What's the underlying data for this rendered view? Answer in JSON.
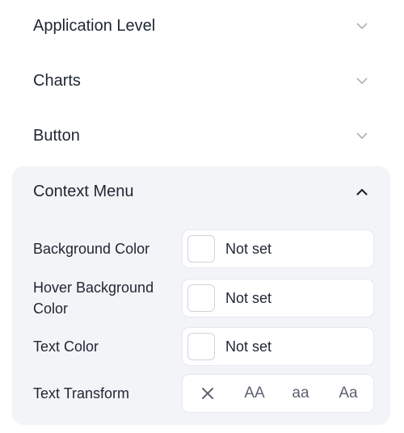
{
  "sections": [
    {
      "title": "Application Level",
      "icon": "chevron-down-icon"
    },
    {
      "title": "Charts",
      "icon": "chevron-down-icon"
    },
    {
      "title": "Button",
      "icon": "chevron-down-icon"
    }
  ],
  "context_menu": {
    "title": "Context Menu",
    "icon": "chevron-up-icon",
    "background_color": {
      "label": "Background Color",
      "value": "Not set"
    },
    "hover_background_color": {
      "label_line1": "Hover Background",
      "label_line2": "Color",
      "value": "Not set"
    },
    "text_color": {
      "label": "Text Color",
      "value": "Not set"
    },
    "text_transform": {
      "label": "Text Transform",
      "options": [
        {
          "label": "×",
          "icon": "close-icon"
        },
        {
          "label": "AA"
        },
        {
          "label": "aa"
        },
        {
          "label": "Aa"
        }
      ]
    }
  },
  "colors": {
    "panel_bg": "#f3f4f7",
    "chevron_collapsed": "#b0b5bd",
    "chevron_expanded": "#1e2533",
    "text": "#1e2533",
    "muted": "#5a6270"
  }
}
